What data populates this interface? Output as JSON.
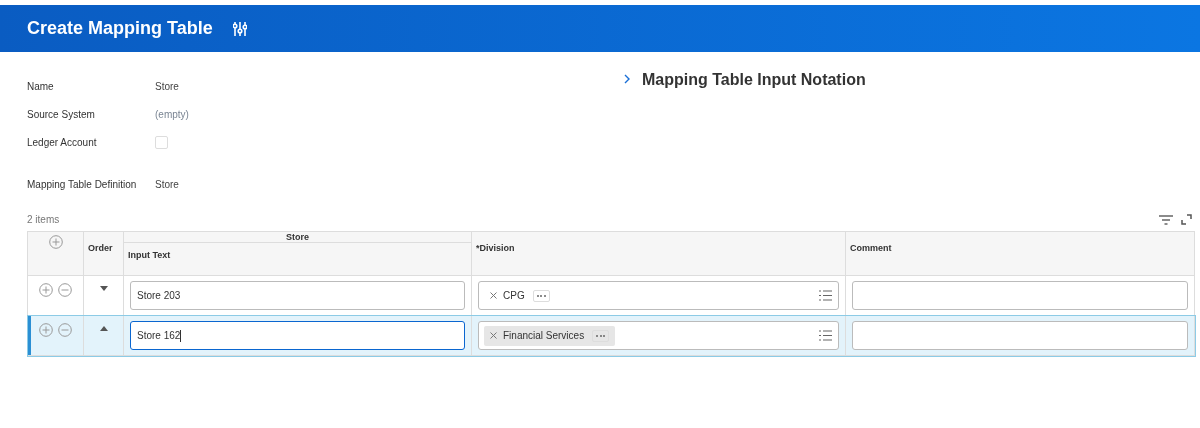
{
  "header": {
    "title": "Create Mapping Table"
  },
  "fields": [
    {
      "label": "Name",
      "kind": "text",
      "value": "Store"
    },
    {
      "label": "Source System",
      "kind": "empty",
      "value": "(empty)"
    },
    {
      "label": "Ledger Account",
      "kind": "checkbox",
      "checked": false
    },
    {
      "label": "Mapping Table Definition",
      "kind": "text",
      "value": "Store"
    }
  ],
  "section": {
    "title": "Mapping Table Input Notation",
    "expanded": false
  },
  "table": {
    "count": "2 items",
    "group_header": "Store",
    "columns": [
      "Order",
      "Input Text",
      "*Division",
      "Comment"
    ],
    "rows": [
      {
        "selected": false,
        "kind": "down",
        "input_text": "Store 203",
        "focused": false,
        "division": [
          {
            "label": "CPG",
            "highlighted": false
          }
        ]
      },
      {
        "selected": true,
        "kind": "up",
        "input_text": "Store 162",
        "focused": true,
        "division": [
          {
            "label": "Financial Services",
            "highlighted": true
          }
        ]
      }
    ]
  }
}
